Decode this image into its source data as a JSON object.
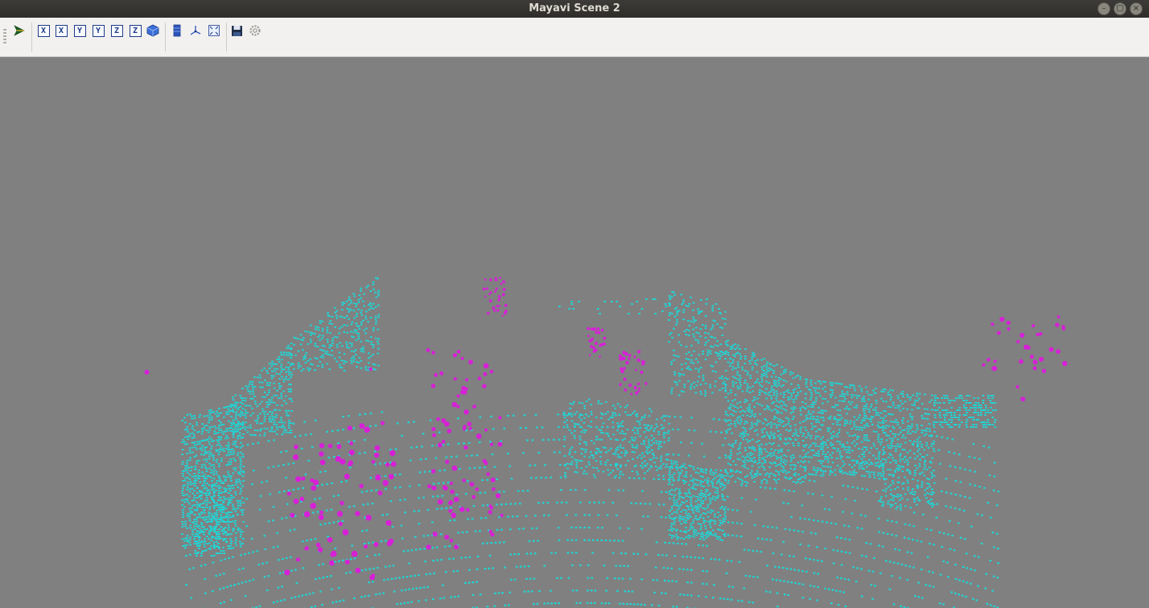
{
  "window": {
    "title": "Mayavi Scene 2"
  },
  "window_buttons": [
    {
      "name": "minimize-button",
      "glyph": "–"
    },
    {
      "name": "maximize-button",
      "glyph": "▢"
    },
    {
      "name": "close-button",
      "glyph": "×"
    }
  ],
  "toolbar": {
    "icons": [
      {
        "name": "mayavi-pipeline-icon"
      },
      {
        "name": "view-x-positive-icon",
        "label": "X"
      },
      {
        "name": "view-x-negative-icon",
        "label": "X"
      },
      {
        "name": "view-y-positive-icon",
        "label": "Y"
      },
      {
        "name": "view-y-negative-icon",
        "label": "Y"
      },
      {
        "name": "view-z-positive-icon",
        "label": "Z"
      },
      {
        "name": "view-z-negative-icon",
        "label": "Z"
      },
      {
        "name": "isometric-view-icon"
      },
      {
        "name": "parallel-projection-icon"
      },
      {
        "name": "show-axes-icon"
      },
      {
        "name": "full-screen-icon"
      },
      {
        "name": "save-icon"
      },
      {
        "name": "configure-scene-icon"
      }
    ]
  },
  "scene": {
    "background_color": "#808080",
    "point_cloud_color": "#1fd6d6",
    "highlight_color": "#d81fd8"
  }
}
